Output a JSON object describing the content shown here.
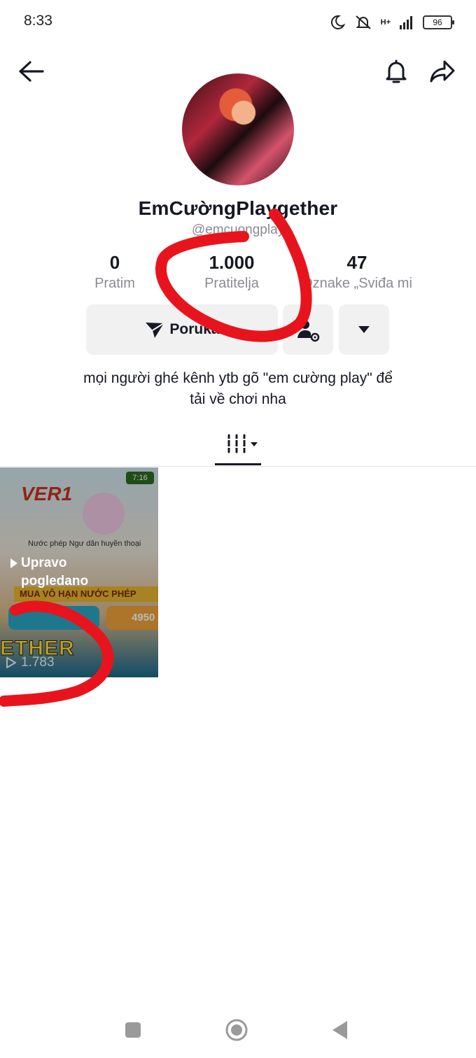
{
  "status_bar": {
    "time": "8:33",
    "network": "H+",
    "battery": "96"
  },
  "profile": {
    "display_name": "EmCườngPlaygether",
    "handle": "@emcuongplay"
  },
  "stats": [
    {
      "value": "0",
      "label": "Pratim"
    },
    {
      "value": "1.000",
      "label": "Pratitelja"
    },
    {
      "value": "47",
      "label": "Oznake „Sviđa mi"
    }
  ],
  "actions": {
    "message_label": "Poruka"
  },
  "bio": {
    "line1": "mọi người ghé kênh ytb gõ \"em cường play\" để",
    "line2": "tải về chơi nha"
  },
  "video": {
    "thumb_title": "VER1",
    "thumb_time_badge": "7:16",
    "thumb_caption": "Nước phép Ngư dân huyền thoại",
    "thumb_banner": "MUA VÔ HẠN NƯỚC PHÉP",
    "thumb_price": "4950",
    "thumb_game_text": "ETHER",
    "pinned_label_line1": "Upravo",
    "pinned_label_line2": "pogledano",
    "views": "1.783"
  },
  "colors": {
    "annotation_red": "#e8141d",
    "button_bg": "#f1f1f2",
    "muted_text": "#8a8b91"
  }
}
